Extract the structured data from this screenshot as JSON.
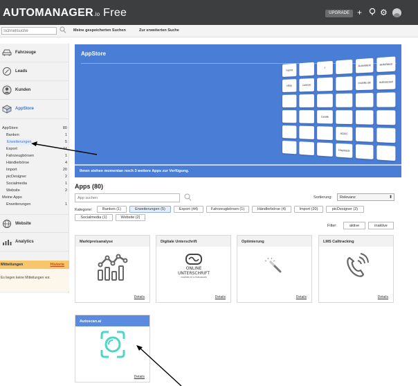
{
  "header": {
    "brand": "AUTOMANAGER",
    "brand_io": ".io",
    "brand_edition": "Free",
    "upgrade_label": "UPGRADE",
    "icons": [
      "plus-icon",
      "help-icon",
      "gear-icon",
      "user-avatar"
    ]
  },
  "searchbar": {
    "placeholder": "Schnellsuche",
    "saved_searches": "Meine gespeicherten Suchen",
    "advanced_search": "Zur erweiterten Suche"
  },
  "sidebar": {
    "items": [
      {
        "label": "Fahrzeuge",
        "icon": "car-icon"
      },
      {
        "label": "Leads",
        "icon": "target-icon"
      },
      {
        "label": "Kunden",
        "icon": "person-icon"
      },
      {
        "label": "AppStore",
        "icon": "box-icon",
        "active": true
      }
    ],
    "appstore_list": [
      {
        "name": "AppStore",
        "count": "80"
      },
      {
        "name": "Banken",
        "count": "1"
      },
      {
        "name": "Erweiterungen",
        "count": "5"
      },
      {
        "name": "Export",
        "count": "44"
      },
      {
        "name": "Fahrzeugbörsen",
        "count": "1"
      },
      {
        "name": "Händlerbörse",
        "count": "4"
      },
      {
        "name": "Import",
        "count": "20"
      },
      {
        "name": "picDesigner",
        "count": "2"
      },
      {
        "name": "Socialmedia",
        "count": "1"
      },
      {
        "name": "Website",
        "count": "2"
      },
      {
        "name": "Meine Apps",
        "count": ""
      },
      {
        "name": "Erweiterungen",
        "count": "1"
      }
    ],
    "bottom_items": [
      {
        "label": "Website",
        "icon": "globe-icon"
      },
      {
        "label": "Analytics",
        "icon": "bar-chart-icon"
      }
    ],
    "notifications": {
      "title": "Mitteilungen",
      "history_link": "Historie",
      "empty_text": "Es liegen keine Mitteilungen vor."
    }
  },
  "banner": {
    "title": "AppStore",
    "footer_text": "Ihnen stehen momentan noch 3 weitere Apps zur Verfügung.",
    "tiles": [
      "hayrat",
      "",
      "f",
      "",
      "AutoWerk",
      "autohaus",
      "eBay",
      "carwow",
      "",
      "",
      "mobile.de",
      "autoscout",
      "",
      "",
      "",
      "",
      "",
      "",
      "",
      "",
      "Carafe",
      "",
      "",
      "",
      "",
      "",
      "",
      "ADAC",
      "",
      "",
      "",
      "",
      "",
      "Haystack",
      "",
      ""
    ]
  },
  "apps": {
    "title": "Apps (80)",
    "search_placeholder": "App suchen",
    "sort_label": "Sortierung:",
    "sort_value": "Relevanz",
    "category_label": "Kategorie:",
    "categories": [
      "Banken (1)",
      "Erweiterungen (5)",
      "Export (44)",
      "Fahrzeugbörsen (1)",
      "Händlerbörse (4)",
      "Import (20)",
      "picDesigner (2)",
      "Socialmedia (1)",
      "Website (2)"
    ],
    "filter_label": "Filter:",
    "filter_active": "aktive",
    "filter_inactive": "inaktive",
    "cards": [
      {
        "title": "Marktpreisanalyse",
        "details": "Details",
        "icon": "market-chart-icon"
      },
      {
        "title": "Digitale Unterschrift",
        "details": "Details",
        "icon": "online-signature-logo",
        "logo_line1": "ONLINE",
        "logo_line2": "UNTERSCHRIFT",
        "logo_line3": "POWERED BY AUTOMANAGER"
      },
      {
        "title": "Optimierung",
        "details": "Details",
        "icon": "wand-icon"
      },
      {
        "title": "LMS Calltracking",
        "details": "Details",
        "icon": "phone-ringing-icon"
      },
      {
        "title": "Autoscan.ai",
        "details": "Details",
        "icon": "autoscan-icon"
      }
    ]
  }
}
